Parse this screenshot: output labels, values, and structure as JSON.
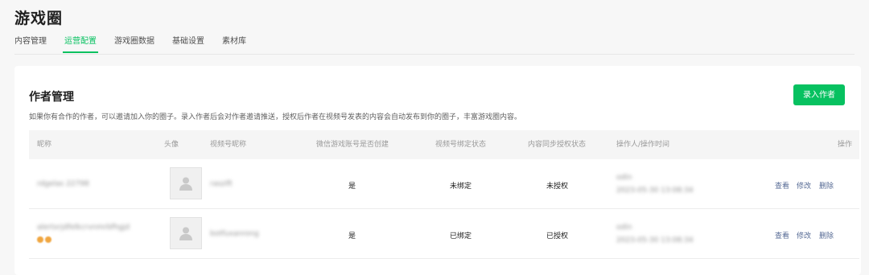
{
  "page": {
    "title": "游戏圈"
  },
  "tabs": [
    {
      "label": "内容管理"
    },
    {
      "label": "运营配置"
    },
    {
      "label": "游戏圈数据"
    },
    {
      "label": "基础设置"
    },
    {
      "label": "素材库"
    }
  ],
  "active_tab": "运营配置",
  "section": {
    "title": "作者管理",
    "description": "如果你有合作的作者，可以邀请加入你的圈子。录入作者后会对作者邀请推送，授权后作者在视频号发表的内容会自动发布到你的圈子，丰富游戏圈内容。",
    "add_button": "录入作者"
  },
  "table": {
    "headers": {
      "nickname": "昵称",
      "avatar": "头像",
      "channel_name": "视频号昵称",
      "wechat_created": "微信游戏账号是否创建",
      "bind_status": "视频号绑定状态",
      "sync_status": "内容同步授权状态",
      "operator": "操作人/操作时间",
      "actions": "操作"
    },
    "rows": [
      {
        "nickname": "rdgelas 22798",
        "channel_name": "raszift",
        "wechat_created": "是",
        "bind_status": "未绑定",
        "sync_status": "未授权",
        "operator": "odin",
        "time": "2023-05-30 13:08:34",
        "actions": {
          "view": "查看",
          "edit": "修改",
          "delete": "删除"
        }
      },
      {
        "nickname": "alertxrjdfelkcrvnmrbfhgjd",
        "channel_name": "botfuxanrong",
        "wechat_created": "是",
        "bind_status": "已绑定",
        "sync_status": "已授权",
        "operator": "odin",
        "time": "2023-05-30 13:08:34",
        "actions": {
          "view": "查看",
          "edit": "修改",
          "delete": "删除"
        }
      }
    ]
  },
  "colors": {
    "accent": "#07c160",
    "link": "#576b95",
    "background": "#f7f7f7"
  },
  "icons": {
    "avatar_placeholder": "person-silhouette-icon"
  }
}
